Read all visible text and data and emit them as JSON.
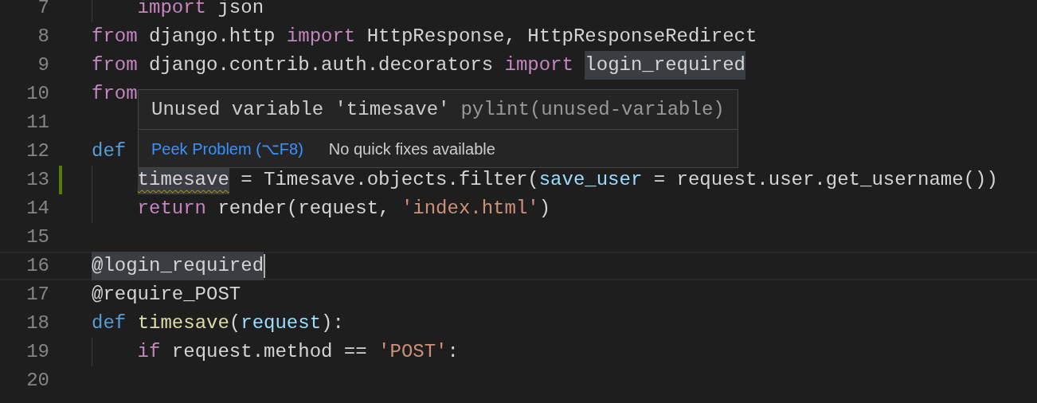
{
  "editor": {
    "lines": [
      {
        "number": "7",
        "modified": false,
        "current": false,
        "tokens": [
          {
            "text": "    import",
            "kind": "keyword",
            "highlighted": false,
            "warning": false
          },
          {
            "text": " json",
            "kind": "plain",
            "highlighted": false,
            "warning": false
          }
        ]
      },
      {
        "number": "8",
        "modified": false,
        "current": false,
        "tokens": [
          {
            "text": "from",
            "kind": "keyword",
            "highlighted": false,
            "warning": false
          },
          {
            "text": " django.http",
            "kind": "plain",
            "highlighted": false,
            "warning": false
          },
          {
            "text": " import",
            "kind": "keyword",
            "highlighted": false,
            "warning": false
          },
          {
            "text": " HttpResponse, HttpResponseRedirect",
            "kind": "plain",
            "highlighted": false,
            "warning": false
          }
        ]
      },
      {
        "number": "9",
        "modified": false,
        "current": false,
        "tokens": [
          {
            "text": "from",
            "kind": "keyword",
            "highlighted": false,
            "warning": false
          },
          {
            "text": " django.contrib.auth.decorators",
            "kind": "plain",
            "highlighted": false,
            "warning": false
          },
          {
            "text": " import",
            "kind": "keyword",
            "highlighted": false,
            "warning": false
          },
          {
            "text": " login_required",
            "kind": "plain",
            "highlighted": true,
            "warning": false
          }
        ]
      },
      {
        "number": "10",
        "modified": false,
        "current": false,
        "tokens": [
          {
            "text": "from",
            "kind": "keyword",
            "highlighted": false,
            "warning": false
          }
        ]
      },
      {
        "number": "11",
        "modified": false,
        "current": false
      },
      {
        "number": "12",
        "modified": false,
        "current": false,
        "tokens": [
          {
            "text": "def",
            "kind": "storage",
            "highlighted": false,
            "warning": false
          }
        ]
      },
      {
        "number": "13",
        "modified": true,
        "current": false,
        "tokens": [
          {
            "text": "    timesave",
            "kind": "plain",
            "highlighted": true,
            "warning": true
          },
          {
            "text": " = Timesave.objects.filter(",
            "kind": "plain",
            "highlighted": false,
            "warning": false
          },
          {
            "text": "save_user",
            "kind": "parameter",
            "highlighted": false,
            "warning": false
          },
          {
            "text": " = request.user.get_username())",
            "kind": "plain",
            "highlighted": false,
            "warning": false
          }
        ]
      },
      {
        "number": "14",
        "modified": false,
        "current": false,
        "tokens": [
          {
            "text": "    return",
            "kind": "keyword",
            "highlighted": false,
            "warning": false
          },
          {
            "text": " render(request,",
            "kind": "plain",
            "highlighted": false,
            "warning": false
          },
          {
            "text": " 'index.html'",
            "kind": "string",
            "highlighted": false,
            "warning": false
          },
          {
            "text": ")",
            "kind": "plain",
            "highlighted": false,
            "warning": false
          }
        ]
      },
      {
        "number": "15",
        "modified": false,
        "current": false
      },
      {
        "number": "16",
        "modified": false,
        "current": true,
        "tokens": [
          {
            "text": "@login_required",
            "kind": "plain",
            "highlighted": true,
            "warning": false
          }
        ]
      },
      {
        "number": "17",
        "modified": false,
        "current": false,
        "tokens": [
          {
            "text": "@require_POST",
            "kind": "plain",
            "highlighted": false,
            "warning": false
          }
        ]
      },
      {
        "number": "18",
        "modified": false,
        "current": false,
        "tokens": [
          {
            "text": "def",
            "kind": "storage",
            "highlighted": false,
            "warning": false
          },
          {
            "text": " timesave",
            "kind": "function",
            "highlighted": false,
            "warning": false
          },
          {
            "text": "(",
            "kind": "plain",
            "highlighted": false,
            "warning": false
          },
          {
            "text": "request",
            "kind": "parameter",
            "highlighted": false,
            "warning": false
          },
          {
            "text": "):",
            "kind": "plain",
            "highlighted": false,
            "warning": false
          }
        ]
      },
      {
        "number": "19",
        "modified": false,
        "current": false,
        "tokens": [
          {
            "text": "    if",
            "kind": "keyword",
            "highlighted": false,
            "warning": false
          },
          {
            "text": " request.method ==",
            "kind": "plain",
            "highlighted": false,
            "warning": false
          },
          {
            "text": " 'POST'",
            "kind": "string",
            "highlighted": false,
            "warning": false
          },
          {
            "text": ":",
            "kind": "plain",
            "highlighted": false,
            "warning": false
          }
        ]
      },
      {
        "number": "20",
        "modified": false,
        "current": false
      }
    ]
  },
  "hover": {
    "message": "Unused variable 'timesave'",
    "source": "pylint(unused-variable)",
    "action": "Peek Problem (⌥F8)",
    "note": "No quick fixes available"
  }
}
